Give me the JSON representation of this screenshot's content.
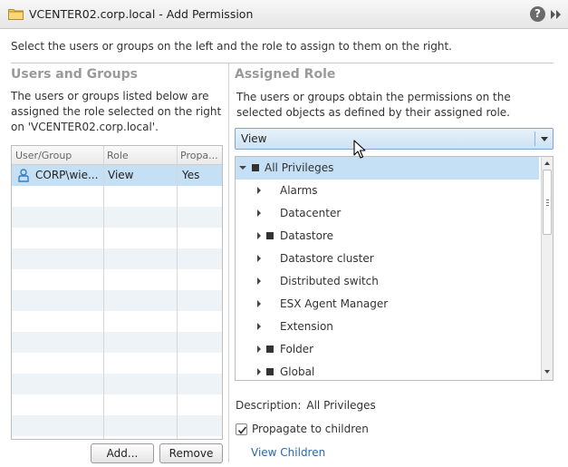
{
  "window": {
    "title": "VCENTER02.corp.local - Add Permission",
    "help_glyph": "?"
  },
  "instruction": "Select the users or groups on the left and the role to assign to them on the right.",
  "users_groups": {
    "title": "Users and Groups",
    "description": "The users or groups listed below are assigned the role selected on the right on 'VCENTER02.corp.local'.",
    "columns": [
      "User/Group",
      "Role",
      "Propa..."
    ],
    "rows": [
      {
        "user": "CORP\\wie...",
        "role": "View",
        "propagate": "Yes"
      }
    ],
    "add_label": "Add...",
    "remove_label": "Remove"
  },
  "assigned_role": {
    "title": "Assigned Role",
    "description": "The users or groups obtain the permissions on the selected objects as defined by their assigned role.",
    "selected_role": "View",
    "tree": [
      {
        "label": "All Privileges",
        "expanded": true,
        "square": true,
        "selected": true
      },
      {
        "label": "Alarms",
        "square": false
      },
      {
        "label": "Datacenter",
        "square": false
      },
      {
        "label": "Datastore",
        "square": true
      },
      {
        "label": "Datastore cluster",
        "square": false
      },
      {
        "label": "Distributed switch",
        "square": false
      },
      {
        "label": "ESX Agent Manager",
        "square": false
      },
      {
        "label": "Extension",
        "square": false
      },
      {
        "label": "Folder",
        "square": true
      },
      {
        "label": "Global",
        "square": true
      }
    ],
    "description_label": "Description:",
    "description_value": "All Privileges",
    "propagate_label": "Propagate to children",
    "propagate_checked": true,
    "view_children_label": "View Children"
  },
  "colors": {
    "selection": "#c5e0f5",
    "link": "#2a6aa8",
    "section_title": "#9a9a9a"
  }
}
